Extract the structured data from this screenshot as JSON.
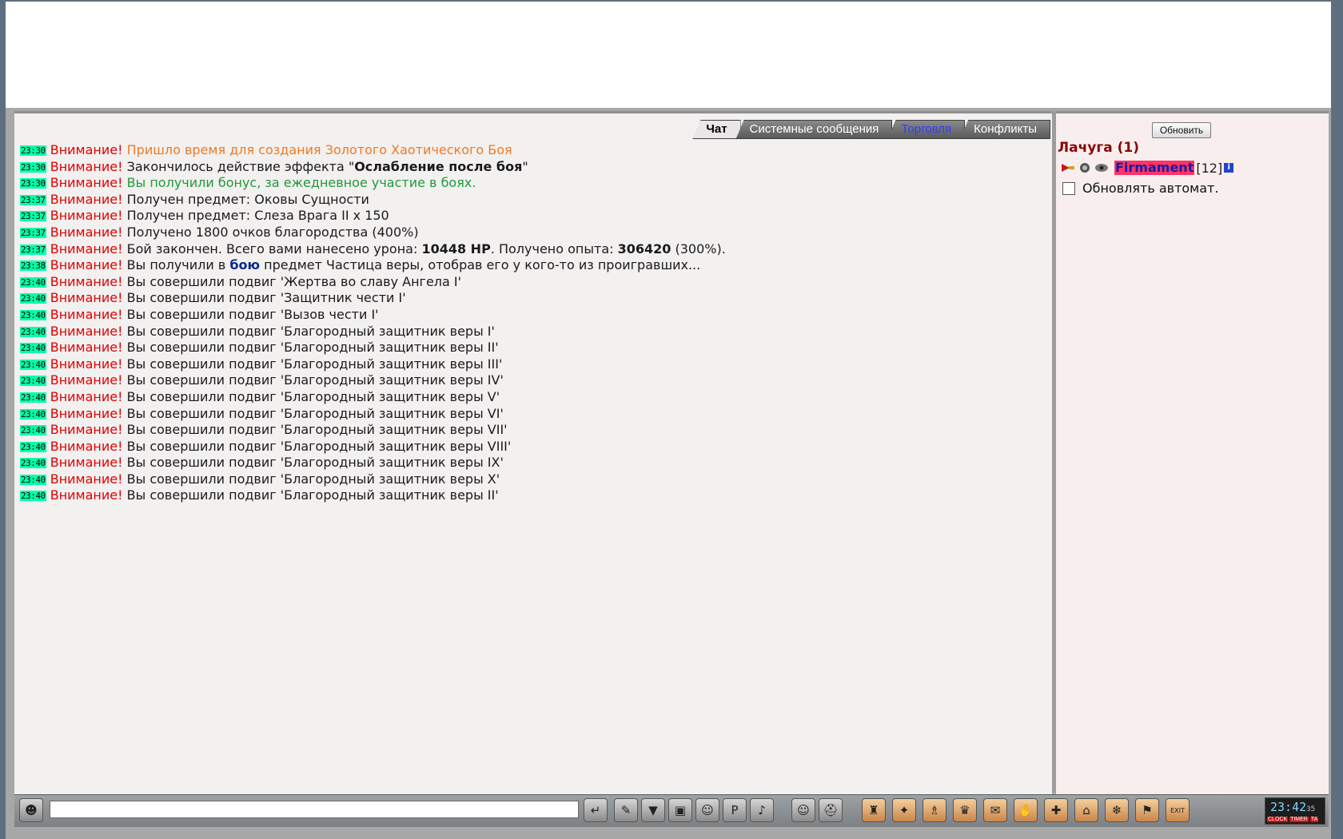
{
  "tabs": [
    {
      "label": "Чат",
      "active": true
    },
    {
      "label": "Системные сообщения",
      "active": false
    },
    {
      "label": "Торговля",
      "active": false
    },
    {
      "label": "Конфликты",
      "active": false
    }
  ],
  "chat": {
    "prefix": "Внимание!",
    "lines": [
      {
        "time": "23:30",
        "parts": [
          {
            "text": "Пришло время для создания Золотого Хаотического Боя",
            "style": "orange"
          }
        ]
      },
      {
        "time": "23:30",
        "parts": [
          {
            "text": "Закончилось действие эффекта \"",
            "style": ""
          },
          {
            "text": "Ослабление после боя",
            "style": "bold"
          },
          {
            "text": "\"",
            "style": ""
          }
        ]
      },
      {
        "time": "23:30",
        "parts": [
          {
            "text": "Вы получили бонус, за ежедневное участие в боях.",
            "style": "green"
          }
        ]
      },
      {
        "time": "23:37",
        "parts": [
          {
            "text": "Получен предмет: Оковы Сущности",
            "style": ""
          }
        ]
      },
      {
        "time": "23:37",
        "parts": [
          {
            "text": "Получен предмет: Слеза Врага II x 150",
            "style": ""
          }
        ]
      },
      {
        "time": "23:37",
        "parts": [
          {
            "text": "Получено 1800 очков благородства (400%)",
            "style": ""
          }
        ]
      },
      {
        "time": "23:37",
        "parts": [
          {
            "text": "Бой закончен. Всего вами нанесено урона: ",
            "style": ""
          },
          {
            "text": "10448 HP",
            "style": "bold"
          },
          {
            "text": ". Получено опыта: ",
            "style": ""
          },
          {
            "text": "306420",
            "style": "bold"
          },
          {
            "text": " (300%).",
            "style": ""
          }
        ]
      },
      {
        "time": "23:38",
        "parts": [
          {
            "text": "Вы получили в ",
            "style": ""
          },
          {
            "text": "бою",
            "style": "link"
          },
          {
            "text": " предмет Частица веры, отобрав его у кого-то из проигравших...",
            "style": ""
          }
        ]
      },
      {
        "time": "23:40",
        "parts": [
          {
            "text": "Вы совершили подвиг 'Жертва во славу Ангела I'",
            "style": ""
          }
        ]
      },
      {
        "time": "23:40",
        "parts": [
          {
            "text": "Вы совершили подвиг 'Защитник чести I'",
            "style": ""
          }
        ]
      },
      {
        "time": "23:40",
        "parts": [
          {
            "text": "Вы совершили подвиг 'Вызов чести I'",
            "style": ""
          }
        ]
      },
      {
        "time": "23:40",
        "parts": [
          {
            "text": "Вы совершили подвиг 'Благородный защитник веры I'",
            "style": ""
          }
        ]
      },
      {
        "time": "23:40",
        "parts": [
          {
            "text": "Вы совершили подвиг 'Благородный защитник веры II'",
            "style": ""
          }
        ]
      },
      {
        "time": "23:40",
        "parts": [
          {
            "text": "Вы совершили подвиг 'Благородный защитник веры III'",
            "style": ""
          }
        ]
      },
      {
        "time": "23:40",
        "parts": [
          {
            "text": "Вы совершили подвиг 'Благородный защитник веры IV'",
            "style": ""
          }
        ]
      },
      {
        "time": "23:40",
        "parts": [
          {
            "text": "Вы совершили подвиг 'Благородный защитник веры V'",
            "style": ""
          }
        ]
      },
      {
        "time": "23:40",
        "parts": [
          {
            "text": "Вы совершили подвиг 'Благородный защитник веры VI'",
            "style": ""
          }
        ]
      },
      {
        "time": "23:40",
        "parts": [
          {
            "text": "Вы совершили подвиг 'Благородный защитник веры VII'",
            "style": ""
          }
        ]
      },
      {
        "time": "23:40",
        "parts": [
          {
            "text": "Вы совершили подвиг 'Благородный защитник веры VIII'",
            "style": ""
          }
        ]
      },
      {
        "time": "23:40",
        "parts": [
          {
            "text": "Вы совершили подвиг 'Благородный защитник веры IX'",
            "style": ""
          }
        ]
      },
      {
        "time": "23:40",
        "parts": [
          {
            "text": "Вы совершили подвиг 'Благородный защитник веры X'",
            "style": ""
          }
        ]
      },
      {
        "time": "23:40",
        "parts": [
          {
            "text": "Вы совершили подвиг 'Благородный защитник веры II'",
            "style": ""
          }
        ]
      }
    ]
  },
  "side": {
    "refresh_label": "Обновить",
    "room_title": "Лачуга (1)",
    "user": {
      "nick": "Firmament",
      "level": "[12]",
      "info": "i"
    },
    "auto_refresh_label": "Обновлять автомат."
  },
  "bottom": {
    "input_value": "",
    "clock_time": "23:42",
    "clock_seconds": "35",
    "clock_label_1": "CLOCK",
    "clock_label_2": "TIMER",
    "clock_label_3": "TA",
    "exit_label": "EXIT"
  },
  "colors": {
    "attention": "#e00000",
    "timestamp_bg": "#00ffaa",
    "nick_bg": "#ff3366",
    "room_title": "#8a0606"
  }
}
